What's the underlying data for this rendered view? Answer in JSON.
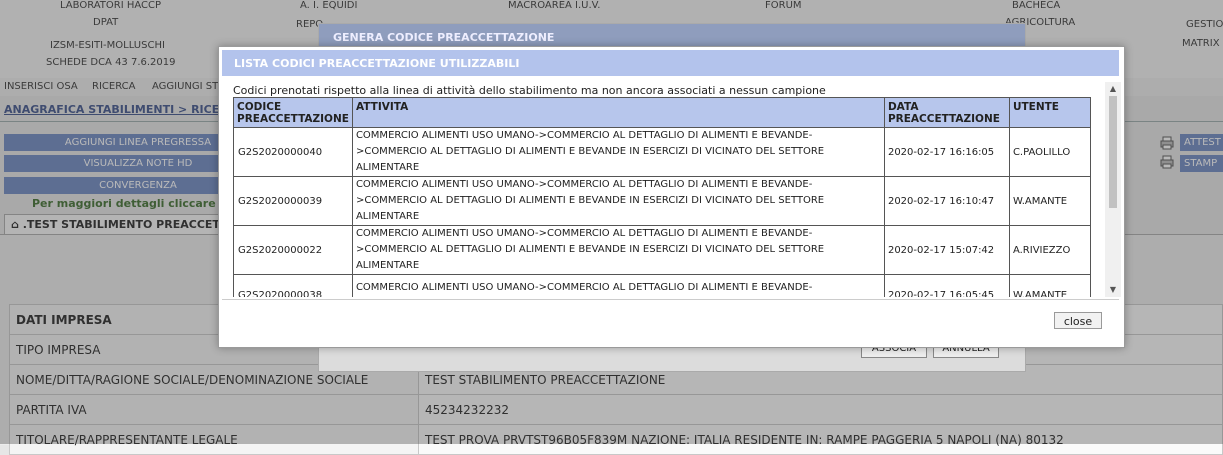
{
  "top_menu": [
    {
      "label": "LABORATORI HACCP"
    },
    {
      "label": "A. I. EQUIDI"
    },
    {
      "label": "MACROAREA I.U.V."
    },
    {
      "label": "FORUM"
    },
    {
      "label": "BACHECA"
    },
    {
      "label": "DPAT"
    },
    {
      "label": "REPO"
    },
    {
      "label": "IZSM-ESITI-MOLLUSCHI"
    },
    {
      "label": "SCHEDE DCA 43 7.6.2019"
    },
    {
      "label": "GESTIO"
    },
    {
      "label": "MATRIX"
    },
    {
      "label": "AGRICOLTURA"
    }
  ],
  "sub_nav": [
    "INSERISCI OSA",
    "RICERCA",
    "AGGIUNGI STI"
  ],
  "breadcrumb": "ANAGRAFICA STABILIMENTI > RICERC",
  "left_buttons": [
    "AGGIUNGI LINEA PREGRESSA",
    "VISUALIZZA NOTE HD",
    "CONVERGENZA"
  ],
  "more_details": "Per maggiori dettagli cliccare QUI",
  "tab_title": ".TEST STABILIMENTO PREACCETTA",
  "right_buttons": [
    "ATTEST",
    "STAMP"
  ],
  "form_rows": [
    {
      "label": "DATI IMPRESA",
      "value": ""
    },
    {
      "label": "TIPO IMPRESA",
      "value": ""
    },
    {
      "label": "NOME/DITTA/RAGIONE SOCIALE/DENOMINAZIONE SOCIALE",
      "value": "TEST STABILIMENTO PREACCETTAZIONE"
    },
    {
      "label": "PARTITA IVA",
      "value": "45234232232"
    },
    {
      "label": "TITOLARE/RAPPRESENTANTE LEGALE",
      "value": "TEST PROVA PRVTST96B05F839M NAZIONE: ITALIA RESIDENTE IN: RAMPE PAGGERIA 5 NAPOLI (NA) 80132"
    }
  ],
  "genera_dialog": {
    "title": "GENERA CODICE PREACCETTAZIONE",
    "associa_label": "ASSOCIA",
    "annulla_label": "ANNULLA"
  },
  "dialog": {
    "title": "LISTA CODICI PREACCETTAZIONE UTILIZZABILI",
    "intro": "Codici prenotati rispetto alla linea di attività dello stabilimento ma non ancora associati a nessun campione",
    "headers": {
      "codice": "CODICE PREACCETTAZIONE",
      "attivita": "ATTIVITA",
      "data": "DATA PREACCETTAZIONE",
      "utente": "UTENTE"
    },
    "rows": [
      {
        "codice": "G2S2020000040",
        "attivita": "COMMERCIO ALIMENTI USO UMANO->COMMERCIO AL DETTAGLIO DI ALIMENTI E BEVANDE->COMMERCIO AL DETTAGLIO DI ALIMENTI E BEVANDE IN ESERCIZI DI VICINATO DEL SETTORE ALIMENTARE",
        "data": "2020-02-17 16:16:05",
        "utente": "C.PAOLILLO"
      },
      {
        "codice": "G2S2020000039",
        "attivita": "COMMERCIO ALIMENTI USO UMANO->COMMERCIO AL DETTAGLIO DI ALIMENTI E BEVANDE->COMMERCIO AL DETTAGLIO DI ALIMENTI E BEVANDE IN ESERCIZI DI VICINATO DEL SETTORE ALIMENTARE",
        "data": "2020-02-17 16:10:47",
        "utente": "W.AMANTE"
      },
      {
        "codice": "G2S2020000022",
        "attivita": "COMMERCIO ALIMENTI USO UMANO->COMMERCIO AL DETTAGLIO DI ALIMENTI E BEVANDE->COMMERCIO AL DETTAGLIO DI ALIMENTI E BEVANDE IN ESERCIZI DI VICINATO DEL SETTORE ALIMENTARE",
        "data": "2020-02-17 15:07:42",
        "utente": "A.RIVIEZZO"
      },
      {
        "codice": "G2S2020000038",
        "attivita": "COMMERCIO ALIMENTI USO UMANO->COMMERCIO AL DETTAGLIO DI ALIMENTI E BEVANDE->TEMPORARY SHOP DI ALIMENTI E BEVANDE",
        "data": "2020-02-17 16:05:45",
        "utente": "W.AMANTE"
      }
    ],
    "close_label": "close"
  }
}
